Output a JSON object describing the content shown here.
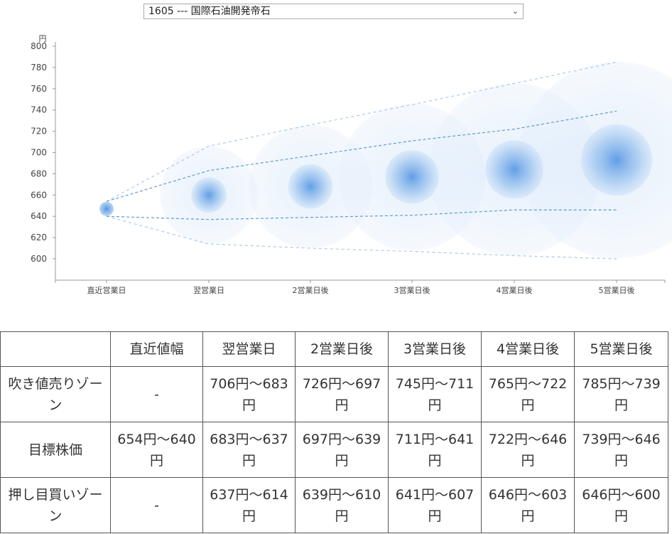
{
  "stock_select": {
    "value": "1605 --- 国際石油開発帝石",
    "chevron_icon": "chevron-down-icon"
  },
  "chart_data": {
    "type": "bubble-band",
    "ylabel": "円",
    "ylim": [
      600,
      800
    ],
    "yticks": [
      600,
      620,
      640,
      660,
      680,
      700,
      720,
      740,
      760,
      780,
      800
    ],
    "categories": [
      "直近営業日",
      "翌営業日",
      "2営業日後",
      "3営業日後",
      "4営業日後",
      "5営業日後"
    ],
    "center": [
      647,
      660,
      668,
      677,
      684,
      693
    ],
    "target_high": [
      654,
      683,
      697,
      711,
      722,
      739
    ],
    "target_low": [
      640,
      637,
      639,
      641,
      646,
      646
    ],
    "sell_high": [
      654,
      706,
      726,
      745,
      765,
      785
    ],
    "buy_low": [
      640,
      614,
      610,
      607,
      603,
      600
    ],
    "colors": {
      "bubble": "#4a90e2",
      "band_inner": "#5b9bd5",
      "band_outer": "#a9c9ec",
      "axis": "#999999"
    }
  },
  "table": {
    "headers": [
      "",
      "直近値幅",
      "翌営業日",
      "2営業日後",
      "3営業日後",
      "4営業日後",
      "5営業日後"
    ],
    "rows": [
      {
        "label": "吹き値売りゾーン",
        "cells": [
          "-",
          "706円～683円",
          "726円～697円",
          "745円～711円",
          "765円～722円",
          "785円～739円"
        ]
      },
      {
        "label": "目標株価",
        "cells": [
          "654円～640円",
          "683円～637円",
          "697円～639円",
          "711円～641円",
          "722円～646円",
          "739円～646円"
        ]
      },
      {
        "label": "押し目買いゾーン",
        "cells": [
          "-",
          "637円～614円",
          "639円～610円",
          "641円～607円",
          "646円～603円",
          "646円～600円"
        ]
      }
    ]
  }
}
